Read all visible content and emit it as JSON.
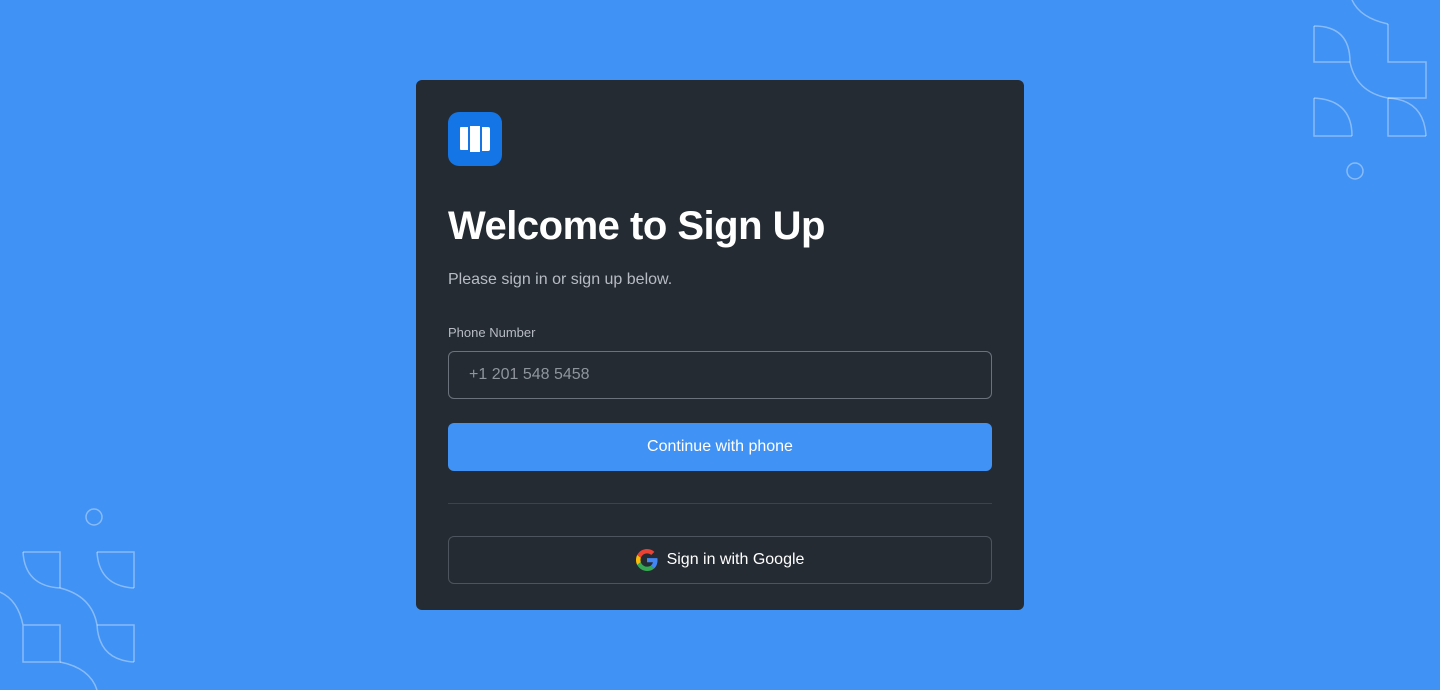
{
  "card": {
    "title": "Welcome to Sign Up",
    "subtitle": "Please sign in or sign up below."
  },
  "phone_field": {
    "label": "Phone Number",
    "placeholder": "+1 201 548 5458",
    "value": ""
  },
  "buttons": {
    "continue_label": "Continue with phone",
    "google_label": "Sign in with Google"
  },
  "icons": {
    "logo": "app-logo-icon",
    "google": "google-icon"
  },
  "colors": {
    "background": "#4092f4",
    "card": "#252b33",
    "primary": "#4092f4",
    "logo": "#1475e6"
  }
}
